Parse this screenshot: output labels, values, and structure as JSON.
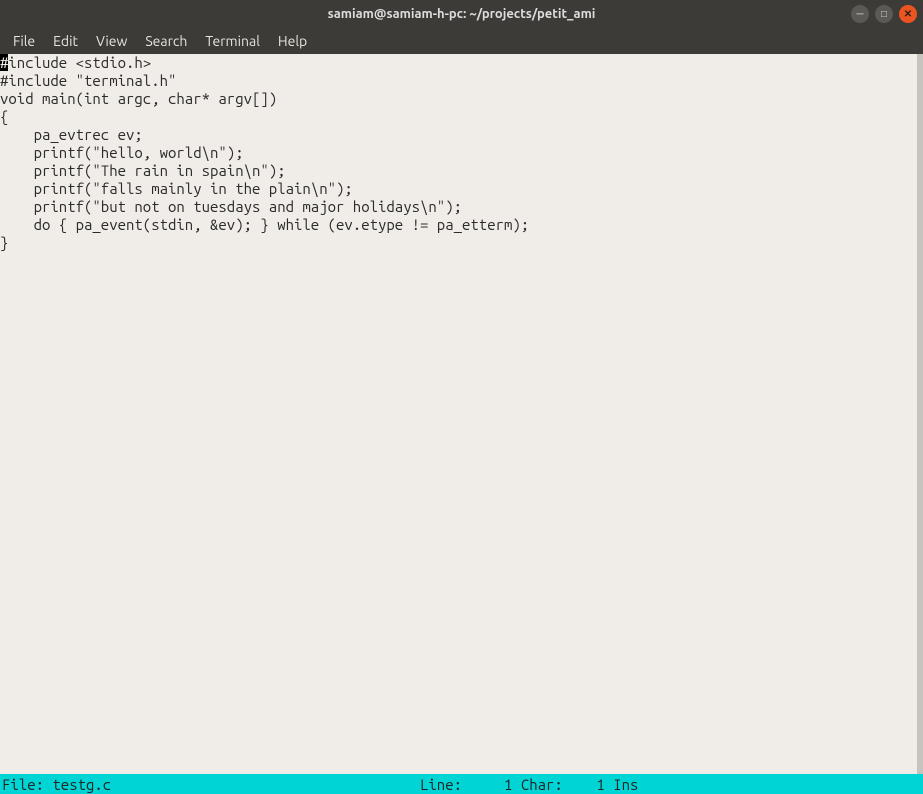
{
  "titlebar": {
    "title": "samiam@samiam-h-pc: ~/projects/petit_ami"
  },
  "window_controls": {
    "minimize_glyph": "─",
    "maximize_glyph": "□",
    "close_glyph": "✕"
  },
  "menubar": {
    "items": [
      {
        "label": "File"
      },
      {
        "label": "Edit"
      },
      {
        "label": "View"
      },
      {
        "label": "Search"
      },
      {
        "label": "Terminal"
      },
      {
        "label": "Help"
      }
    ]
  },
  "editor": {
    "cursor_char": "#",
    "line0_rest": "include <stdio.h>",
    "lines": [
      "",
      "#include \"terminal.h\"",
      "",
      "void main(int argc, char* argv[])",
      "",
      "{",
      "",
      "    pa_evtrec ev;",
      "",
      "    printf(\"hello, world\\n\");",
      "    printf(\"The rain in spain\\n\");",
      "    printf(\"falls mainly in the plain\\n\");",
      "    printf(\"but not on tuesdays and major holidays\\n\");",
      "",
      "    do { pa_event(stdin, &ev); } while (ev.etype != pa_etterm);",
      "",
      "}"
    ]
  },
  "statusbar": {
    "file_label": "File: ",
    "file_name": "testg.c",
    "line_label": "Line:",
    "line_value": "     1",
    "char_label": " Char:",
    "char_value": "    1",
    "mode": " Ins"
  }
}
